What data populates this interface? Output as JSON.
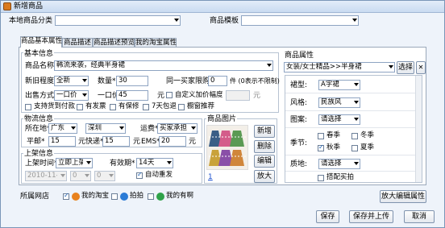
{
  "window": {
    "title": "新增商品"
  },
  "top": {
    "category_label": "本地商品分类",
    "category_value": "",
    "template_label": "商品模板",
    "template_value": ""
  },
  "tabs": [
    {
      "label": "商品基本属性",
      "active": true
    },
    {
      "label": "商品描述",
      "active": false
    },
    {
      "label": "商品描述预览",
      "active": false
    },
    {
      "label": "我的淘宝属性",
      "active": false
    }
  ],
  "basic": {
    "group_title": "基本信息",
    "name_label": "商品名称*",
    "name_value": "韩流来袭，经典半身裙",
    "condition_label": "新旧程度*",
    "condition_value": "全新",
    "quantity_label": "数量*",
    "quantity_value": "30",
    "limit_label": "同一买家限购",
    "limit_value": "0",
    "limit_note": "件 (0表示不限制)",
    "sale_mode_label": "出售方式*",
    "sale_mode_value": "一口价",
    "price_label": "一口价",
    "price_value": "45",
    "price_unit": "元",
    "custom_markup_label": "自定义加价幅度",
    "custom_markup_unit": "元",
    "checks": [
      {
        "label": "支持货到付款",
        "checked": false
      },
      {
        "label": "有发票",
        "checked": false
      },
      {
        "label": "有保修",
        "checked": false
      },
      {
        "label": "7天包退",
        "checked": false
      },
      {
        "label": "橱窗推荐",
        "checked": false
      }
    ]
  },
  "logistics": {
    "group_title": "物流信息",
    "location_label": "所在地*",
    "province": "广东",
    "city": "深圳",
    "freight_label": "运费*",
    "freight_value": "买家承担",
    "mail_label": "平邮*",
    "mail_value": "15",
    "mail_unit": "元",
    "express_label": "快递*",
    "express_value": "15",
    "express_unit": "元",
    "ems_label": "EMS*",
    "ems_value": "20",
    "ems_unit": "元"
  },
  "listing": {
    "group_title": "上架信息",
    "time_label": "上架时间*",
    "time_value": "立即上架",
    "period_label": "有效期*",
    "period_value": "14天",
    "date_value": "2010-11-29",
    "time_h": "0",
    "time_m": "0",
    "auto_relist_label": "自动重发",
    "auto_relist_checked": true
  },
  "image": {
    "group_title": "商品图片",
    "page_link": "1",
    "buttons": {
      "add": "新增",
      "delete": "删除",
      "edit": "编辑",
      "zoom": "放大"
    }
  },
  "attributes": {
    "group_title": "商品属性",
    "category_path": "女装/女士精品>>半身裙",
    "select_button": "选择",
    "close_button": "✕",
    "rows": [
      {
        "label": "裙型:",
        "value": "A字裙"
      },
      {
        "label": "风格:",
        "value": "民族风"
      },
      {
        "label": "图案:",
        "value": "请选择"
      }
    ],
    "season_label": "季节:",
    "seasons": [
      {
        "label": "春季",
        "checked": false
      },
      {
        "label": "冬季",
        "checked": false
      },
      {
        "label": "秋季",
        "checked": true
      },
      {
        "label": "夏季",
        "checked": false
      }
    ],
    "material_label": "质地:",
    "material_value": "请选择",
    "match_label": "搭配买拍",
    "match_checked": false
  },
  "bottom": {
    "shop_label": "所属网店",
    "shops": [
      {
        "label": "我的淘宝",
        "checked": true,
        "color": "#e8821e"
      },
      {
        "label": "拍拍",
        "checked": false,
        "color": "#2b7bd6"
      },
      {
        "label": "我的有啊",
        "checked": false,
        "color": "#2fa24a"
      }
    ],
    "zoom_attr_button": "放大编辑属性",
    "save_button": "保存",
    "save_upload_button": "保存并上传",
    "cancel_button": "取消"
  }
}
